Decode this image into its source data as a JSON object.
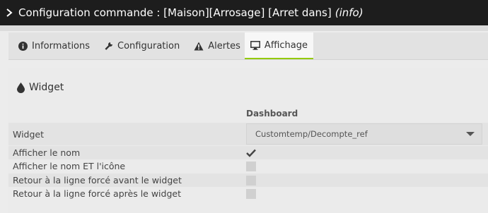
{
  "window": {
    "title": "Configuration commande : [Maison][Arrosage] [Arret dans]",
    "title_suffix": "(info)"
  },
  "tabs": [
    {
      "label": "Informations",
      "icon": "info-circle-icon"
    },
    {
      "label": "Configuration",
      "icon": "wrench-icon"
    },
    {
      "label": "Alertes",
      "icon": "warning-icon"
    },
    {
      "label": "Affichage",
      "icon": "monitor-icon",
      "active": true
    }
  ],
  "section": {
    "title": "Widget",
    "icon": "tint-drop-icon",
    "column_header": "Dashboard"
  },
  "rows": {
    "widget": {
      "label": "Widget",
      "value": "Customtemp/Decompte_ref"
    },
    "show_name": {
      "label": "Afficher le nom",
      "checked": true
    },
    "show_name_icon": {
      "label": "Afficher le nom ET l'icône",
      "checked": false
    },
    "break_before": {
      "label": "Retour à la ligne forcé avant le widget",
      "checked": false
    },
    "break_after": {
      "label": "Retour à la ligne forcé après le widget",
      "checked": false
    }
  },
  "colors": {
    "titlebar": "#1d1d1d",
    "active_tab_underline": "#93ca02"
  }
}
